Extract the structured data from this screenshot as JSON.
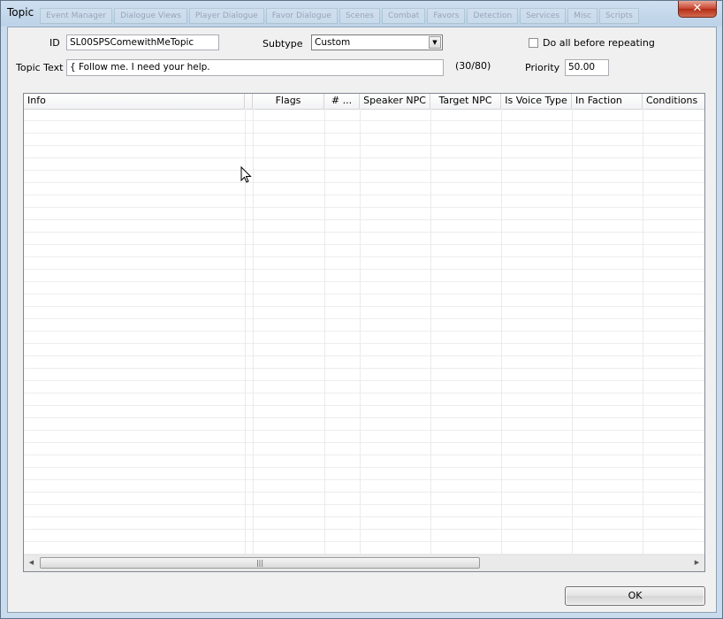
{
  "window": {
    "title": "Topic",
    "close_label": "✕",
    "background_tabs": [
      "Event Manager",
      "Dialogue Views",
      "Player Dialogue",
      "Favor Dialogue",
      "Scenes",
      "Combat",
      "Favors",
      "Detection",
      "Services",
      "Misc",
      "Scripts"
    ]
  },
  "form": {
    "id_label": "ID",
    "id_value": "SL00SPSComewithMeTopic",
    "subtype_label": "Subtype",
    "subtype_value": "Custom",
    "do_all_label": "Do all before repeating",
    "do_all_checked": false,
    "topic_text_label": "Topic Text",
    "topic_text_value": "{ Follow me. I need your help.",
    "char_count": "(30/80)",
    "priority_label": "Priority",
    "priority_value": "50.00"
  },
  "list": {
    "columns": [
      "Info",
      "Flags",
      "# ...",
      "Speaker NPC",
      "Target NPC",
      "Is Voice Type",
      "In Faction",
      "Conditions"
    ],
    "rows": []
  },
  "scrollbar": {
    "left_arrow": "◀",
    "right_arrow": "▶",
    "grip": "|||"
  },
  "buttons": {
    "ok_label": "OK"
  }
}
